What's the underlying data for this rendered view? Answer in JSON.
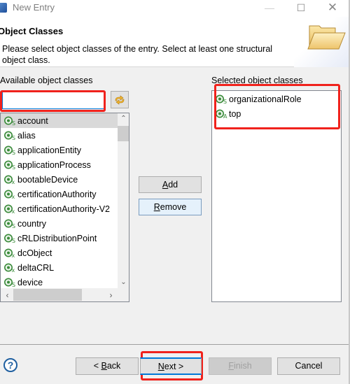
{
  "window": {
    "title": "New Entry",
    "controls": {
      "minimize": "—",
      "maximize": "☐",
      "close": "✕"
    }
  },
  "banner": {
    "heading": "Object Classes",
    "description": "Please select object classes of the entry. Select at least one structural object class.",
    "icon": "folder-open-icon"
  },
  "available": {
    "label": "Available object classes",
    "filter_value": "",
    "filter_placeholder": "",
    "refresh_icon": "refresh-icon",
    "items": [
      {
        "label": "account",
        "kind": "structural",
        "selected": true
      },
      {
        "label": "alias",
        "kind": "structural",
        "selected": false
      },
      {
        "label": "applicationEntity",
        "kind": "structural",
        "selected": false
      },
      {
        "label": "applicationProcess",
        "kind": "structural",
        "selected": false
      },
      {
        "label": "bootableDevice",
        "kind": "auxiliary-x",
        "selected": false
      },
      {
        "label": "certificationAuthority",
        "kind": "auxiliary-x",
        "selected": false
      },
      {
        "label": "certificationAuthority-V2",
        "kind": "auxiliary-x",
        "selected": false
      },
      {
        "label": "country",
        "kind": "structural",
        "selected": false
      },
      {
        "label": "cRLDistributionPoint",
        "kind": "structural",
        "selected": false
      },
      {
        "label": "dcObject",
        "kind": "auxiliary-x",
        "selected": false
      },
      {
        "label": "deltaCRL",
        "kind": "auxiliary-x",
        "selected": false
      },
      {
        "label": "device",
        "kind": "structural",
        "selected": false
      }
    ]
  },
  "buttons": {
    "add": {
      "prefix": "",
      "mnemonic": "A",
      "rest": "dd"
    },
    "remove": {
      "prefix": "",
      "mnemonic": "R",
      "rest": "emove"
    },
    "back": {
      "prefix": "< ",
      "mnemonic": "B",
      "rest": "ack"
    },
    "next": {
      "prefix": "",
      "mnemonic": "N",
      "rest": "ext >"
    },
    "finish": {
      "prefix": "",
      "mnemonic": "F",
      "rest": "inish"
    },
    "cancel": {
      "label": "Cancel"
    },
    "help": "?"
  },
  "selected": {
    "label": "Selected object classes",
    "items": [
      {
        "label": "organizationalRole",
        "kind": "structural"
      },
      {
        "label": "top",
        "kind": "abstract"
      }
    ]
  },
  "colors": {
    "highlight_box": "#f0221c",
    "focus_blue": "#0078d7",
    "icon_green": "#3a8a3a"
  }
}
